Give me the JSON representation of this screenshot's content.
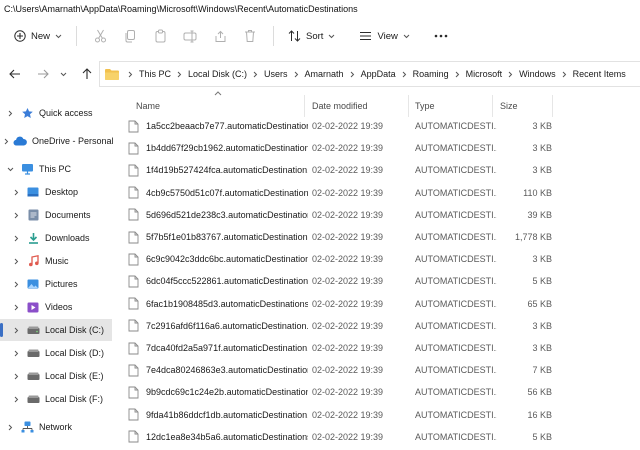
{
  "window": {
    "title": "C:\\Users\\Amarnath\\AppData\\Roaming\\Microsoft\\Windows\\Recent\\AutomaticDestinations"
  },
  "toolbar": {
    "new_label": "New",
    "sort_label": "Sort",
    "view_label": "View",
    "icons": [
      "plus-icon",
      "cut-icon",
      "copy-icon",
      "paste-icon",
      "rename-icon",
      "share-icon",
      "delete-icon",
      "sort-icon",
      "view-icon",
      "more-icon"
    ]
  },
  "address": {
    "crumbs": [
      "This PC",
      "Local Disk (C:)",
      "Users",
      "Amarnath",
      "AppData",
      "Roaming",
      "Microsoft",
      "Windows",
      "Recent Items"
    ]
  },
  "sidebar": {
    "items": [
      {
        "label": "Quick access",
        "icon": "star-icon",
        "color": "#3b7dd8"
      },
      {
        "label": "OneDrive - Personal",
        "icon": "cloud-icon",
        "color": "#2a7ad5"
      },
      {
        "label": "This PC",
        "icon": "monitor-icon",
        "color": "#3b8fe0"
      },
      {
        "label": "Desktop",
        "icon": "desktop-icon",
        "color": "#3b8fe0"
      },
      {
        "label": "Documents",
        "icon": "documents-icon",
        "color": "#7a8ea8"
      },
      {
        "label": "Downloads",
        "icon": "download-icon",
        "color": "#2a9d8f"
      },
      {
        "label": "Music",
        "icon": "music-icon",
        "color": "#e05a4f"
      },
      {
        "label": "Pictures",
        "icon": "pictures-icon",
        "color": "#3b8fe0"
      },
      {
        "label": "Videos",
        "icon": "videos-icon",
        "color": "#8b4fc9"
      },
      {
        "label": "Local Disk (C:)",
        "icon": "drive-icon",
        "color": "#6a6a6a"
      },
      {
        "label": "Local Disk (D:)",
        "icon": "drive-icon",
        "color": "#6a6a6a"
      },
      {
        "label": "Local Disk (E:)",
        "icon": "drive-icon",
        "color": "#6a6a6a"
      },
      {
        "label": "Local Disk (F:)",
        "icon": "drive-icon",
        "color": "#6a6a6a"
      },
      {
        "label": "Network",
        "icon": "network-icon",
        "color": "#3b8fe0"
      }
    ]
  },
  "columns": {
    "name": "Name",
    "date": "Date modified",
    "type": "Type",
    "size": "Size"
  },
  "files": [
    {
      "name": "1a5cc2beaacb7e77.automaticDestination...",
      "date": "02-02-2022 19:39",
      "type": "AUTOMATICDESTI...",
      "size": "3 KB"
    },
    {
      "name": "1b4dd67f29cb1962.automaticDestination...",
      "date": "02-02-2022 19:39",
      "type": "AUTOMATICDESTI...",
      "size": "3 KB"
    },
    {
      "name": "1f4d19b527424fca.automaticDestination...",
      "date": "02-02-2022 19:39",
      "type": "AUTOMATICDESTI...",
      "size": "3 KB"
    },
    {
      "name": "4cb9c5750d51c07f.automaticDestination...",
      "date": "02-02-2022 19:39",
      "type": "AUTOMATICDESTI...",
      "size": "110 KB"
    },
    {
      "name": "5d696d521de238c3.automaticDestination...",
      "date": "02-02-2022 19:39",
      "type": "AUTOMATICDESTI...",
      "size": "39 KB"
    },
    {
      "name": "5f7b5f1e01b83767.automaticDestination...",
      "date": "02-02-2022 19:39",
      "type": "AUTOMATICDESTI...",
      "size": "1,778 KB"
    },
    {
      "name": "6c9c9042c3ddc6bc.automaticDestination...",
      "date": "02-02-2022 19:39",
      "type": "AUTOMATICDESTI...",
      "size": "3 KB"
    },
    {
      "name": "6dc04f5ccc522861.automaticDestination...",
      "date": "02-02-2022 19:39",
      "type": "AUTOMATICDESTI...",
      "size": "5 KB"
    },
    {
      "name": "6fac1b1908485d3.automaticDestinations-...",
      "date": "02-02-2022 19:39",
      "type": "AUTOMATICDESTI...",
      "size": "65 KB"
    },
    {
      "name": "7c2916afd6f116a6.automaticDestination...",
      "date": "02-02-2022 19:39",
      "type": "AUTOMATICDESTI...",
      "size": "3 KB"
    },
    {
      "name": "7dca40fd2a5a971f.automaticDestination...",
      "date": "02-02-2022 19:39",
      "type": "AUTOMATICDESTI...",
      "size": "3 KB"
    },
    {
      "name": "7e4dca80246863e3.automaticDestination...",
      "date": "02-02-2022 19:39",
      "type": "AUTOMATICDESTI...",
      "size": "7 KB"
    },
    {
      "name": "9b9cdc69c1c24e2b.automaticDestination...",
      "date": "02-02-2022 19:39",
      "type": "AUTOMATICDESTI...",
      "size": "56 KB"
    },
    {
      "name": "9fda41b86ddcf1db.automaticDestination...",
      "date": "02-02-2022 19:39",
      "type": "AUTOMATICDESTI...",
      "size": "16 KB"
    },
    {
      "name": "12dc1ea8e34b5a6.automaticDestinations...",
      "date": "02-02-2022 19:39",
      "type": "AUTOMATICDESTI...",
      "size": "5 KB"
    }
  ]
}
